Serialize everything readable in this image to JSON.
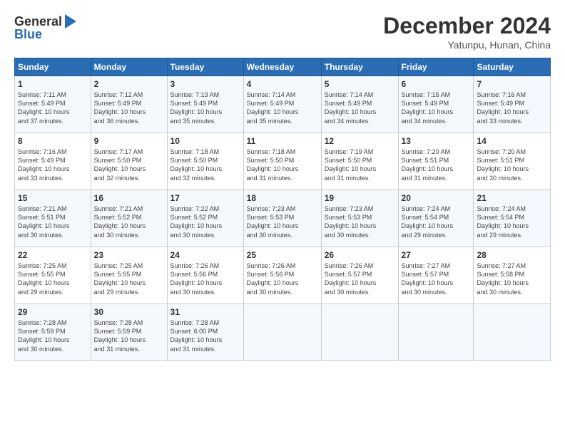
{
  "header": {
    "logo_line1": "General",
    "logo_line2": "Blue",
    "month": "December 2024",
    "location": "Yatunpu, Hunan, China"
  },
  "days_of_week": [
    "Sunday",
    "Monday",
    "Tuesday",
    "Wednesday",
    "Thursday",
    "Friday",
    "Saturday"
  ],
  "weeks": [
    [
      {
        "day": "1",
        "info": "Sunrise: 7:11 AM\nSunset: 5:49 PM\nDaylight: 10 hours\nand 37 minutes."
      },
      {
        "day": "2",
        "info": "Sunrise: 7:12 AM\nSunset: 5:49 PM\nDaylight: 10 hours\nand 36 minutes."
      },
      {
        "day": "3",
        "info": "Sunrise: 7:13 AM\nSunset: 5:49 PM\nDaylight: 10 hours\nand 35 minutes."
      },
      {
        "day": "4",
        "info": "Sunrise: 7:14 AM\nSunset: 5:49 PM\nDaylight: 10 hours\nand 35 minutes."
      },
      {
        "day": "5",
        "info": "Sunrise: 7:14 AM\nSunset: 5:49 PM\nDaylight: 10 hours\nand 34 minutes."
      },
      {
        "day": "6",
        "info": "Sunrise: 7:15 AM\nSunset: 5:49 PM\nDaylight: 10 hours\nand 34 minutes."
      },
      {
        "day": "7",
        "info": "Sunrise: 7:16 AM\nSunset: 5:49 PM\nDaylight: 10 hours\nand 33 minutes."
      }
    ],
    [
      {
        "day": "8",
        "info": "Sunrise: 7:16 AM\nSunset: 5:49 PM\nDaylight: 10 hours\nand 33 minutes."
      },
      {
        "day": "9",
        "info": "Sunrise: 7:17 AM\nSunset: 5:50 PM\nDaylight: 10 hours\nand 32 minutes."
      },
      {
        "day": "10",
        "info": "Sunrise: 7:18 AM\nSunset: 5:50 PM\nDaylight: 10 hours\nand 32 minutes."
      },
      {
        "day": "11",
        "info": "Sunrise: 7:18 AM\nSunset: 5:50 PM\nDaylight: 10 hours\nand 31 minutes."
      },
      {
        "day": "12",
        "info": "Sunrise: 7:19 AM\nSunset: 5:50 PM\nDaylight: 10 hours\nand 31 minutes."
      },
      {
        "day": "13",
        "info": "Sunrise: 7:20 AM\nSunset: 5:51 PM\nDaylight: 10 hours\nand 31 minutes."
      },
      {
        "day": "14",
        "info": "Sunrise: 7:20 AM\nSunset: 5:51 PM\nDaylight: 10 hours\nand 30 minutes."
      }
    ],
    [
      {
        "day": "15",
        "info": "Sunrise: 7:21 AM\nSunset: 5:51 PM\nDaylight: 10 hours\nand 30 minutes."
      },
      {
        "day": "16",
        "info": "Sunrise: 7:21 AM\nSunset: 5:52 PM\nDaylight: 10 hours\nand 30 minutes."
      },
      {
        "day": "17",
        "info": "Sunrise: 7:22 AM\nSunset: 5:52 PM\nDaylight: 10 hours\nand 30 minutes."
      },
      {
        "day": "18",
        "info": "Sunrise: 7:23 AM\nSunset: 5:53 PM\nDaylight: 10 hours\nand 30 minutes."
      },
      {
        "day": "19",
        "info": "Sunrise: 7:23 AM\nSunset: 5:53 PM\nDaylight: 10 hours\nand 30 minutes."
      },
      {
        "day": "20",
        "info": "Sunrise: 7:24 AM\nSunset: 5:54 PM\nDaylight: 10 hours\nand 29 minutes."
      },
      {
        "day": "21",
        "info": "Sunrise: 7:24 AM\nSunset: 5:54 PM\nDaylight: 10 hours\nand 29 minutes."
      }
    ],
    [
      {
        "day": "22",
        "info": "Sunrise: 7:25 AM\nSunset: 5:55 PM\nDaylight: 10 hours\nand 29 minutes."
      },
      {
        "day": "23",
        "info": "Sunrise: 7:25 AM\nSunset: 5:55 PM\nDaylight: 10 hours\nand 29 minutes."
      },
      {
        "day": "24",
        "info": "Sunrise: 7:26 AM\nSunset: 5:56 PM\nDaylight: 10 hours\nand 30 minutes."
      },
      {
        "day": "25",
        "info": "Sunrise: 7:26 AM\nSunset: 5:56 PM\nDaylight: 10 hours\nand 30 minutes."
      },
      {
        "day": "26",
        "info": "Sunrise: 7:26 AM\nSunset: 5:57 PM\nDaylight: 10 hours\nand 30 minutes."
      },
      {
        "day": "27",
        "info": "Sunrise: 7:27 AM\nSunset: 5:57 PM\nDaylight: 10 hours\nand 30 minutes."
      },
      {
        "day": "28",
        "info": "Sunrise: 7:27 AM\nSunset: 5:58 PM\nDaylight: 10 hours\nand 30 minutes."
      }
    ],
    [
      {
        "day": "29",
        "info": "Sunrise: 7:28 AM\nSunset: 5:59 PM\nDaylight: 10 hours\nand 30 minutes."
      },
      {
        "day": "30",
        "info": "Sunrise: 7:28 AM\nSunset: 5:59 PM\nDaylight: 10 hours\nand 31 minutes."
      },
      {
        "day": "31",
        "info": "Sunrise: 7:28 AM\nSunset: 6:00 PM\nDaylight: 10 hours\nand 31 minutes."
      },
      {
        "day": "",
        "info": ""
      },
      {
        "day": "",
        "info": ""
      },
      {
        "day": "",
        "info": ""
      },
      {
        "day": "",
        "info": ""
      }
    ]
  ]
}
